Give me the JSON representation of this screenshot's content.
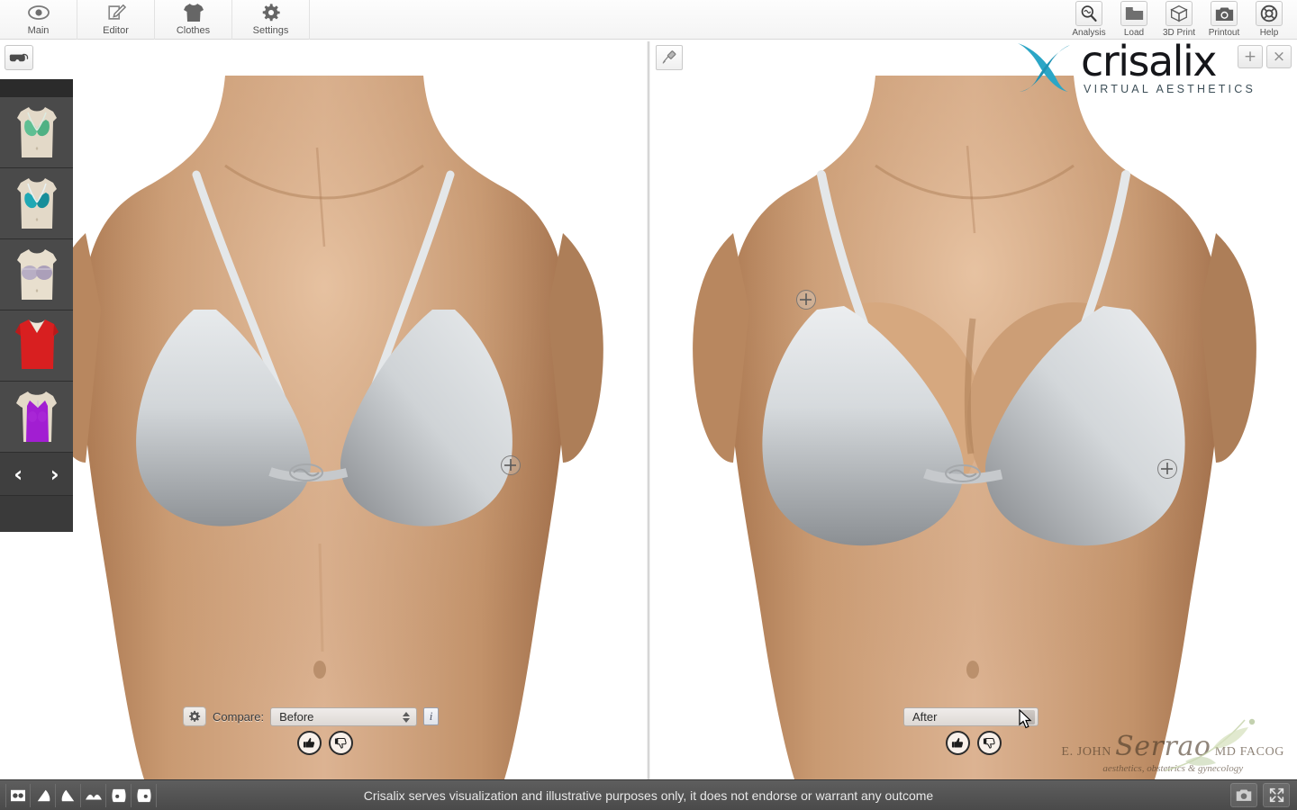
{
  "app": {
    "brand_name": "crisalix",
    "brand_tagline": "VIRTUAL AESTHETICS",
    "brand_color": "#2ba6c6"
  },
  "toolbar_left": {
    "items": [
      {
        "label": "Main",
        "icon": "eye-icon"
      },
      {
        "label": "Editor",
        "icon": "edit-pencil-icon"
      },
      {
        "label": "Clothes",
        "icon": "tshirt-icon"
      },
      {
        "label": "Settings",
        "icon": "gear-icon"
      }
    ]
  },
  "toolbar_right": {
    "items": [
      {
        "label": "Analysis",
        "icon": "magnifier-waveform-icon"
      },
      {
        "label": "Load",
        "icon": "folder-icon"
      },
      {
        "label": "3D Print",
        "icon": "cube-icon"
      },
      {
        "label": "Printout",
        "icon": "camera-icon"
      },
      {
        "label": "Help",
        "icon": "lifering-icon"
      }
    ]
  },
  "window_buttons": {
    "add_label": "+",
    "close_label": "×"
  },
  "sidebar": {
    "vr_button_icon": "vr-goggles-icon",
    "thumbnails": [
      {
        "name": "green-bikini-top",
        "color": "#5fbf93",
        "skin": "#e3d9c8"
      },
      {
        "name": "teal-bikini-top",
        "color": "#1fa8b4",
        "skin": "#e3d9c8"
      },
      {
        "name": "lilac-bra",
        "color": "#b8aec4",
        "skin": "#e3d9c8"
      },
      {
        "name": "red-vneck-top",
        "color": "#d81f20",
        "skin": "#e3d9c8"
      },
      {
        "name": "purple-tank-top",
        "color": "#a21ed2",
        "skin": "#e3d9c8"
      }
    ],
    "prev_label": "‹",
    "next_label": "›"
  },
  "viewport_left": {
    "tool_icon": null,
    "compare": {
      "gear_icon": "gear-icon",
      "label": "Compare:",
      "selected": "Before",
      "options": [
        "Before",
        "After"
      ],
      "info_label": "i"
    },
    "votes": {
      "up_icon": "thumbs-up-icon",
      "down_icon": "thumbs-down-icon"
    }
  },
  "viewport_right": {
    "tool_icon": "syringe-icon",
    "compare": {
      "selected": "After",
      "options": [
        "Before",
        "After"
      ]
    },
    "votes": {
      "up_icon": "thumbs-up-icon",
      "down_icon": "thumbs-down-icon"
    }
  },
  "watermark": {
    "line1_prefix": "E. JOHN",
    "script": "Serrao",
    "line1_suffix": "MD FACOG",
    "line2": "aesthetics, obstetrics & gynecology"
  },
  "bottom_bar": {
    "disclaimer": "Crisalix serves visualization and illustrative purposes only, it does not endorse or warrant any outcome",
    "view_icons": [
      "view-front-icon",
      "view-left-oblique-icon",
      "view-right-oblique-icon",
      "view-top-icon",
      "view-three-quarter-left-icon",
      "view-three-quarter-right-icon"
    ],
    "right_tools": [
      "snapshot-camera-icon",
      "fullscreen-icon"
    ]
  }
}
